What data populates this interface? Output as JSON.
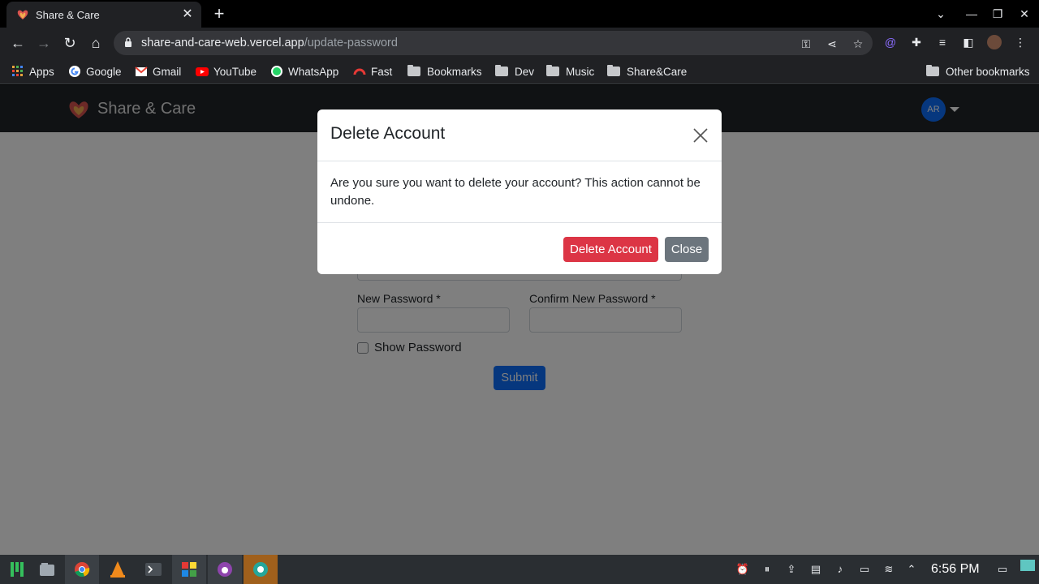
{
  "browser": {
    "tab_title": "Share & Care",
    "url_host": "share-and-care-web.vercel.app",
    "url_path": "/update-password",
    "bookmarks": [
      "Apps",
      "Google",
      "Gmail",
      "YouTube",
      "WhatsApp",
      "Fast",
      "Bookmarks",
      "Dev",
      "Music",
      "Share&Care"
    ],
    "other_bookmarks": "Other bookmarks"
  },
  "site": {
    "brand": "Share & Care",
    "avatar_initials": "AR"
  },
  "form": {
    "new_password_label": "New Password *",
    "confirm_password_label": "Confirm New Password *",
    "show_password_label": "Show Password",
    "submit_label": "Submit"
  },
  "modal": {
    "title": "Delete Account",
    "body": "Are you sure you want to delete your account? This action cannot be undone.",
    "confirm_label": "Delete Account",
    "close_label": "Close"
  },
  "taskbar": {
    "time": "6:56 PM"
  },
  "colors": {
    "danger": "#dc3545",
    "secondary": "#6c757d",
    "primary": "#0d6efd",
    "navbar": "#212529"
  }
}
